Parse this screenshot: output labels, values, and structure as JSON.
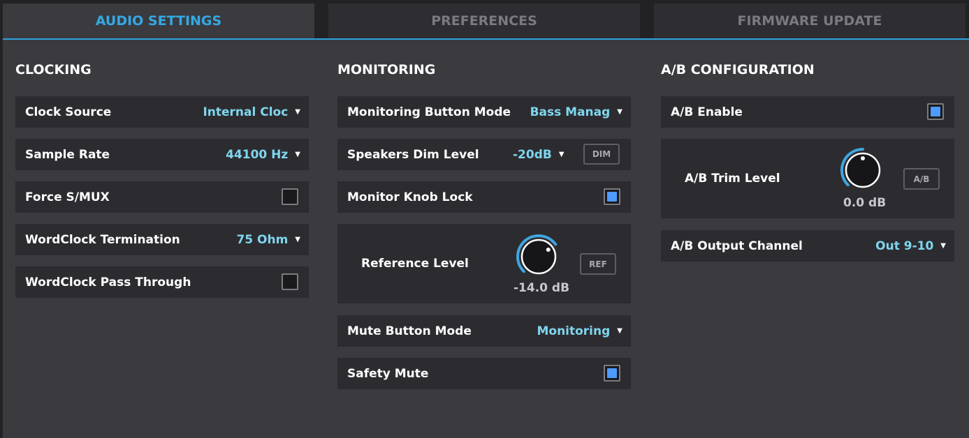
{
  "tabs": [
    {
      "label": "AUDIO SETTINGS",
      "active": true
    },
    {
      "label": "PREFERENCES",
      "active": false
    },
    {
      "label": "FIRMWARE UPDATE",
      "active": false
    }
  ],
  "clocking": {
    "title": "CLOCKING",
    "clock_source": {
      "label": "Clock Source",
      "value": "Internal Cloc"
    },
    "sample_rate": {
      "label": "Sample Rate",
      "value": "44100 Hz"
    },
    "force_smux": {
      "label": "Force S/MUX",
      "checked": false
    },
    "wordclock_termination": {
      "label": "WordClock Termination",
      "value": "75 Ohm"
    },
    "wordclock_pass_through": {
      "label": "WordClock Pass Through",
      "checked": false
    }
  },
  "monitoring": {
    "title": "MONITORING",
    "button_mode": {
      "label": "Monitoring Button Mode",
      "value": "Bass Manag"
    },
    "dim_level": {
      "label": "Speakers Dim Level",
      "value": "-20dB",
      "button": "DIM"
    },
    "knob_lock": {
      "label": "Monitor Knob Lock",
      "checked": true
    },
    "reference_level": {
      "label": "Reference Level",
      "value": "-14.0 dB",
      "button": "REF",
      "knob_fraction": 0.7
    },
    "mute_mode": {
      "label": "Mute Button Mode",
      "value": "Monitoring"
    },
    "safety_mute": {
      "label": "Safety Mute",
      "checked": true
    }
  },
  "ab": {
    "title": "A/B CONFIGURATION",
    "enable": {
      "label": "A/B Enable",
      "checked": true
    },
    "trim_level": {
      "label": "A/B Trim Level",
      "value": "0.0 dB",
      "button": "A/B",
      "knob_fraction": 0.5
    },
    "output_channel": {
      "label": "A/B Output Channel",
      "value": "Out 9-10"
    }
  },
  "colors": {
    "accent": "#33a9e2",
    "value_text": "#7fd6ee",
    "checkbox_on": "#4d9bff",
    "knob_arc": "#3fa6e0"
  },
  "icons": {
    "dropdown": "caret-down-icon",
    "checkbox": "checkbox-icon"
  }
}
